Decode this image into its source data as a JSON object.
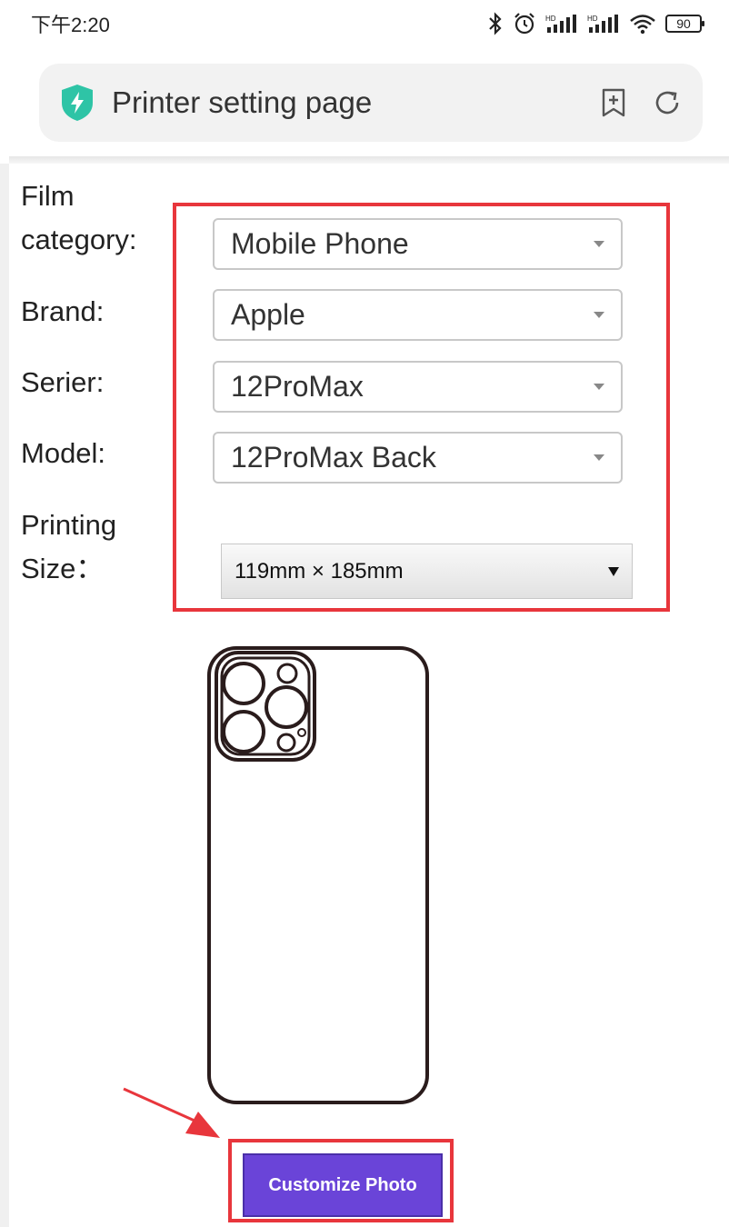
{
  "status_bar": {
    "time": "下午2:20",
    "battery": "90",
    "icons": [
      "bluetooth-icon",
      "alarm-icon",
      "signal-hd-icon",
      "signal-hd-icon",
      "wifi-icon",
      "battery-icon"
    ]
  },
  "url_bar": {
    "title": "Printer setting page",
    "icons": [
      "shield-icon",
      "bookmark-add-icon",
      "refresh-icon"
    ]
  },
  "form": {
    "film_category": {
      "label": "Film category:",
      "value": "Mobile Phone"
    },
    "brand": {
      "label": "Brand:",
      "value": "Apple"
    },
    "series": {
      "label": "Serier:",
      "value": "12ProMax"
    },
    "model": {
      "label": "Model:",
      "value": "12ProMax Back"
    },
    "printing_size": {
      "label": "Printing Size：",
      "value": "119mm × 185mm"
    }
  },
  "action": {
    "customize_label": "Customize Photo"
  },
  "colors": {
    "highlight_red": "#e8363c",
    "button_purple": "#6a44d8",
    "shield_teal": "#2ec4a6"
  }
}
